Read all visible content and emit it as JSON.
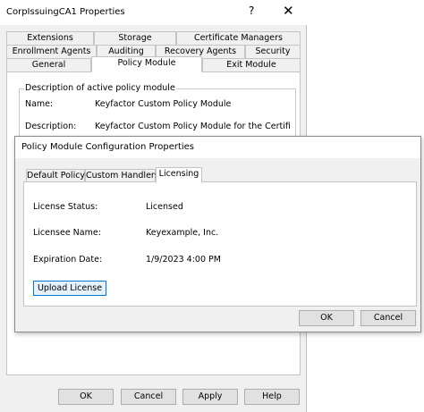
{
  "outer_window": {
    "title": "CorpIssuingCA1 Properties",
    "help_glyph": "?",
    "close_glyph": "✕",
    "tabs_row1": [
      "Extensions",
      "Storage",
      "Certificate Managers"
    ],
    "tabs_row2": [
      "Enrollment Agents",
      "Auditing",
      "Recovery Agents",
      "Security"
    ],
    "tabs_row3": [
      "General",
      "Policy Module",
      "Exit Module"
    ],
    "group_title": "Description of active policy module",
    "name_label": "Name:",
    "name_value": "Keyfactor Custom Policy Module",
    "description_label": "Description:",
    "description_value": "Keyfactor Custom Policy Module for the Certificate",
    "buttons": {
      "ok": "OK",
      "cancel": "Cancel",
      "apply": "Apply",
      "help": "Help"
    }
  },
  "inner_dialog": {
    "title": "Policy Module Configuration Properties",
    "tabs": [
      "Default Policy",
      "Custom Handlers",
      "Licensing"
    ],
    "active_tab": "Licensing",
    "fields": {
      "status_label": "License Status:",
      "status_value": "Licensed",
      "licensee_label": "Licensee Name:",
      "licensee_value": "Keyexample, Inc.",
      "expiration_label": "Expiration Date:",
      "expiration_value": "1/9/2023 4:00 PM"
    },
    "upload_button": "Upload License",
    "buttons": {
      "ok": "OK",
      "cancel": "Cancel"
    }
  }
}
